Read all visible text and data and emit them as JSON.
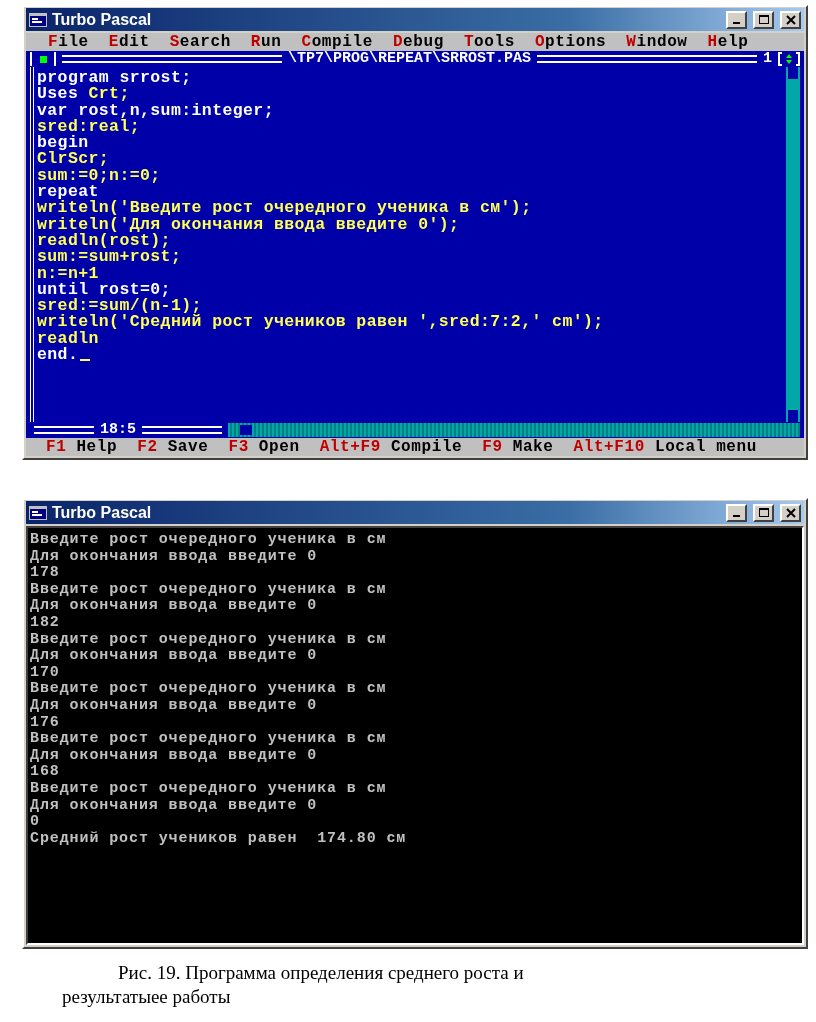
{
  "editor_window": {
    "title": "Turbo Pascal",
    "menu": [
      {
        "label": "File"
      },
      {
        "label": "Edit"
      },
      {
        "label": "Search"
      },
      {
        "label": "Run"
      },
      {
        "label": "Compile"
      },
      {
        "label": "Debug"
      },
      {
        "label": "Tools"
      },
      {
        "label": "Options"
      },
      {
        "label": "Window"
      },
      {
        "label": "Help"
      }
    ],
    "frame_title": "\\TP7\\PROG\\REPEAT\\SRROST.PAS",
    "window_number": "1",
    "cursor_position": "18:5",
    "code_lines": [
      {
        "segments": [
          {
            "text": "program srrost;",
            "kind": "keyword"
          }
        ]
      },
      {
        "segments": [
          {
            "text": "Uses ",
            "kind": "keyword"
          },
          {
            "text": "Crt;",
            "kind": "code"
          }
        ]
      },
      {
        "segments": [
          {
            "text": "var rost,n,sum:integer;",
            "kind": "keyword"
          }
        ]
      },
      {
        "segments": [
          {
            "text": "sred:real;",
            "kind": "code"
          }
        ]
      },
      {
        "segments": [
          {
            "text": "begin",
            "kind": "keyword"
          }
        ]
      },
      {
        "segments": [
          {
            "text": "ClrScr;",
            "kind": "code"
          }
        ]
      },
      {
        "segments": [
          {
            "text": "sum:=0;n:=0;",
            "kind": "code"
          }
        ]
      },
      {
        "segments": [
          {
            "text": "repeat",
            "kind": "keyword"
          }
        ]
      },
      {
        "segments": [
          {
            "text": "writeln('Введите рост очередного ученика в см');",
            "kind": "code"
          }
        ]
      },
      {
        "segments": [
          {
            "text": "writeln('Для окончания ввода введите 0');",
            "kind": "code"
          }
        ]
      },
      {
        "segments": [
          {
            "text": "readln(rost);",
            "kind": "code"
          }
        ]
      },
      {
        "segments": [
          {
            "text": "sum:=sum+rost;",
            "kind": "code"
          }
        ]
      },
      {
        "segments": [
          {
            "text": "n:=n+1",
            "kind": "code"
          }
        ]
      },
      {
        "segments": [
          {
            "text": "until rost=0;",
            "kind": "keyword"
          }
        ]
      },
      {
        "segments": [
          {
            "text": "sred:=sum/(n-1);",
            "kind": "code"
          }
        ]
      },
      {
        "segments": [
          {
            "text": "writeln('Средний рост учеников равен ',sred:7:2,' cm');",
            "kind": "code"
          }
        ]
      },
      {
        "segments": [
          {
            "text": "readln",
            "kind": "code"
          }
        ]
      },
      {
        "segments": [
          {
            "text": "end.",
            "kind": "keyword"
          }
        ],
        "cursor": true
      }
    ],
    "status_bar": [
      {
        "key": "F1",
        "label": "Help"
      },
      {
        "key": "F2",
        "label": "Save"
      },
      {
        "key": "F3",
        "label": "Open"
      },
      {
        "key": "Alt+F9",
        "label": "Compile"
      },
      {
        "key": "F9",
        "label": "Make"
      },
      {
        "key": "Alt+F10",
        "label": "Local menu"
      }
    ]
  },
  "output_window": {
    "title": "Turbo Pascal",
    "lines": [
      "Введите рост очередного ученика в см",
      "Для окончания ввода введите 0",
      "178",
      "Введите рост очередного ученика в см",
      "Для окончания ввода введите 0",
      "182",
      "Введите рост очередного ученика в см",
      "Для окончания ввода введите 0",
      "170",
      "Введите рост очередного ученика в см",
      "Для окончания ввода введите 0",
      "176",
      "Введите рост очередного ученика в см",
      "Для окончания ввода введите 0",
      "168",
      "Введите рост очередного ученика в см",
      "Для окончания ввода введите 0",
      "0",
      "Средний рост учеников равен  174.80 см"
    ]
  },
  "caption": "Рис. 19. Программа определения среднего роста и результатыее работы"
}
